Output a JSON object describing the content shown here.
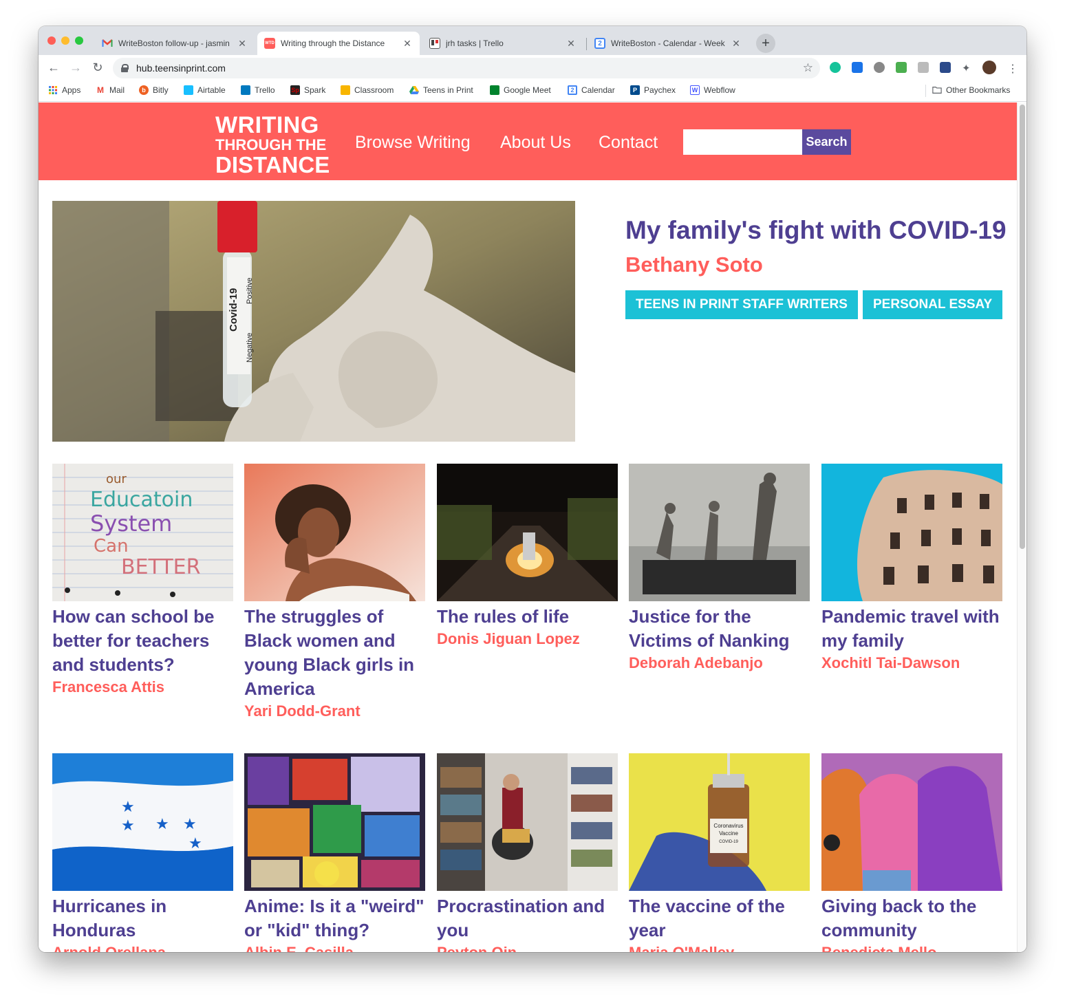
{
  "browser": {
    "tabs": [
      {
        "title": "WriteBoston follow-up - jasmin",
        "icon": "gmail-icon",
        "active": false
      },
      {
        "title": "Writing through the Distance",
        "icon": "wtd-icon",
        "active": true
      },
      {
        "title": "jrh tasks | Trello",
        "icon": "trello-icon",
        "active": false
      },
      {
        "title": "WriteBoston - Calendar - Week",
        "icon": "calendar-icon",
        "active": false
      }
    ],
    "url": "hub.teensinprint.com",
    "bookmarks": [
      {
        "label": "Apps",
        "icon": "apps-grid-icon",
        "color": "#4285f4"
      },
      {
        "label": "Mail",
        "icon": "gmail-icon",
        "color": "#ea4335"
      },
      {
        "label": "Bitly",
        "icon": "bitly-icon",
        "color": "#ee6123"
      },
      {
        "label": "Airtable",
        "icon": "airtable-icon",
        "color": "#18bfff"
      },
      {
        "label": "Trello",
        "icon": "trello-icon",
        "color": "#0079bf"
      },
      {
        "label": "Spark",
        "icon": "spark-icon",
        "color": "#cc0000"
      },
      {
        "label": "Classroom",
        "icon": "classroom-icon",
        "color": "#f8b500"
      },
      {
        "label": "Teens in Print",
        "icon": "drive-icon",
        "color": "#1fa463"
      },
      {
        "label": "Google Meet",
        "icon": "meet-icon",
        "color": "#00832d"
      },
      {
        "label": "Calendar",
        "icon": "calendar-icon",
        "color": "#4285f4"
      },
      {
        "label": "Paychex",
        "icon": "paychex-icon",
        "color": "#004b8d"
      },
      {
        "label": "Webflow",
        "icon": "webflow-icon",
        "color": "#4353ff"
      }
    ],
    "other_bookmarks": "Other Bookmarks"
  },
  "site": {
    "logo": {
      "line1": "WRITING",
      "line2": "THROUGH THE",
      "line3": "DISTANCE"
    },
    "nav": [
      "Browse Writing",
      "About Us",
      "Contact"
    ],
    "search": {
      "value": "",
      "button": "Search"
    },
    "colors": {
      "header": "#ff5e5b",
      "title": "#4e3f91",
      "author": "#ff5e5b",
      "tag": "#1cc1d6",
      "search": "#5b4a9e"
    }
  },
  "featured": {
    "title": "My family's fight with COVID-19",
    "author": "Bethany Soto",
    "tags": [
      "TEENS IN PRINT STAFF WRITERS",
      "PERSONAL ESSAY"
    ],
    "image_text": [
      "Covid-19",
      "Positive",
      "Negative"
    ]
  },
  "articles": [
    {
      "title": "How can school be better for teachers and students?",
      "author": "Francesca Attis",
      "image_text": [
        "our",
        "Educatoin",
        "System",
        "Can",
        "BETTER"
      ]
    },
    {
      "title": "The struggles of Black women and young Black girls in America",
      "author": "Yari Dodd-Grant"
    },
    {
      "title": "The rules of life",
      "author": "Donis Jiguan Lopez"
    },
    {
      "title": "Justice for the Victims of Nanking",
      "author": "Deborah Adebanjo"
    },
    {
      "title": "Pandemic travel with my family",
      "author": "Xochitl Tai-Dawson"
    },
    {
      "title": "Hurricanes in Honduras",
      "author": "Arnold Orellana"
    },
    {
      "title": "Anime: Is it a \"weird\" or \"kid\" thing?",
      "author": "Albin E. Casilla"
    },
    {
      "title": "Procrastination and you",
      "author": "Peyton Qin"
    },
    {
      "title": "The vaccine of the year",
      "author": "Maria O'Malley",
      "image_text": [
        "Coronavirus",
        "Vaccine",
        "COVID-19"
      ]
    },
    {
      "title": "Giving back to the community",
      "author": "Benedicta Mello"
    }
  ]
}
